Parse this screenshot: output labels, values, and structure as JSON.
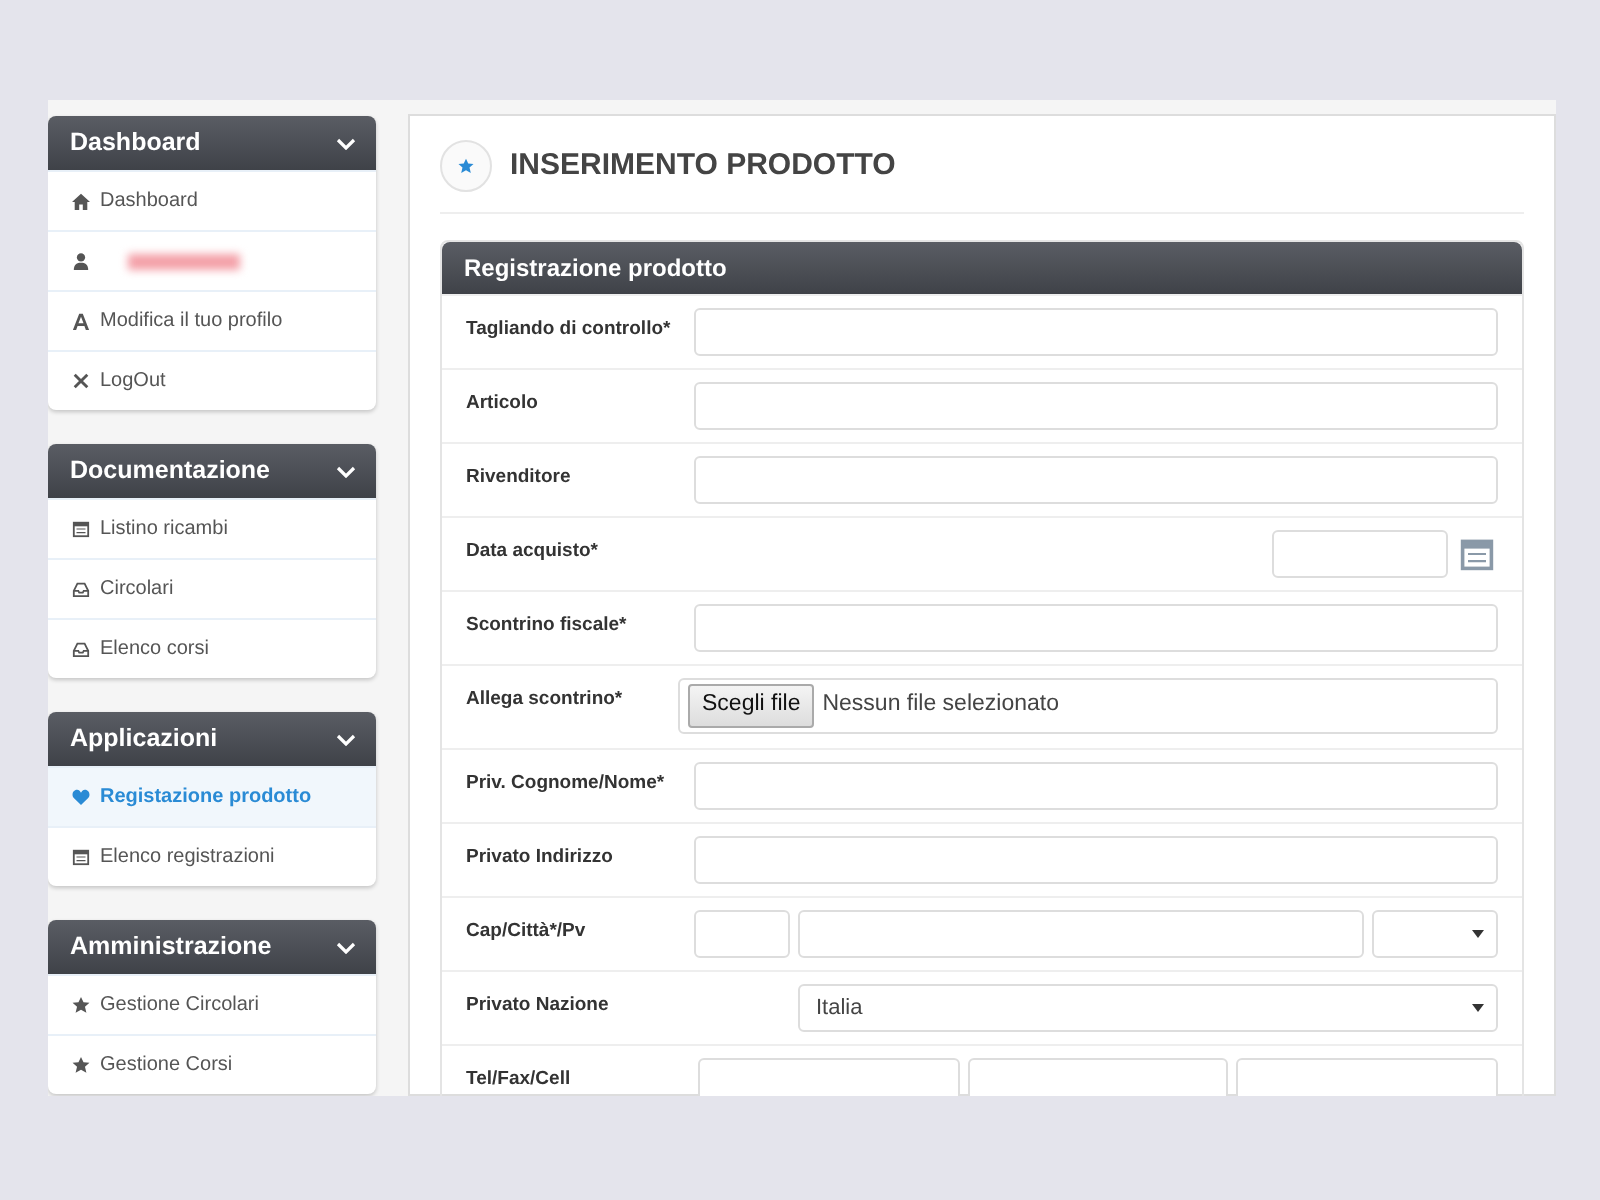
{
  "sidebar": {
    "panels": [
      {
        "title": "Dashboard",
        "items": [
          {
            "kind": "home",
            "label": "Dashboard",
            "selected": false
          },
          {
            "kind": "user",
            "redacted": true,
            "selected": false
          },
          {
            "kind": "font",
            "label": "Modifica il tuo profilo",
            "selected": false
          },
          {
            "kind": "close",
            "label": "LogOut",
            "selected": false
          }
        ]
      },
      {
        "title": "Documentazione",
        "items": [
          {
            "kind": "calendar",
            "label": "Listino ricambi",
            "selected": false
          },
          {
            "kind": "inbox",
            "label": "Circolari",
            "selected": false
          },
          {
            "kind": "inbox",
            "label": "Elenco corsi",
            "selected": false
          }
        ]
      },
      {
        "title": "Applicazioni",
        "items": [
          {
            "kind": "heart",
            "label": "Registazione prodotto",
            "selected": true
          },
          {
            "kind": "calendar",
            "label": "Elenco registrazioni",
            "selected": false
          }
        ]
      },
      {
        "title": "Amministrazione",
        "items": [
          {
            "kind": "star",
            "label": "Gestione Circolari",
            "selected": false
          },
          {
            "kind": "star",
            "label": "Gestione Corsi",
            "selected": false
          }
        ]
      }
    ]
  },
  "page": {
    "title": "INSERIMENTO PRODOTTO"
  },
  "form": {
    "title": "Registrazione prodotto",
    "rows": [
      {
        "label": "Tagliando di controllo*",
        "kind": "text"
      },
      {
        "label": "Articolo",
        "kind": "text"
      },
      {
        "label": "Rivenditore",
        "kind": "text"
      },
      {
        "label": "Data acquisto*",
        "kind": "date"
      },
      {
        "label": "Scontrino fiscale*",
        "kind": "text"
      },
      {
        "label": "Allega scontrino*",
        "kind": "file",
        "button": "Scegli file",
        "status": "Nessun file selezionato"
      },
      {
        "label": "Priv. Cognome/Nome*",
        "kind": "text"
      },
      {
        "label": "Privato Indirizzo",
        "kind": "text"
      },
      {
        "label": "Cap/Città*/Pv",
        "kind": "address"
      },
      {
        "label": "Privato Nazione",
        "kind": "select",
        "value": "Italia"
      },
      {
        "label": "Tel/Fax/Cell",
        "kind": "triple"
      }
    ]
  }
}
